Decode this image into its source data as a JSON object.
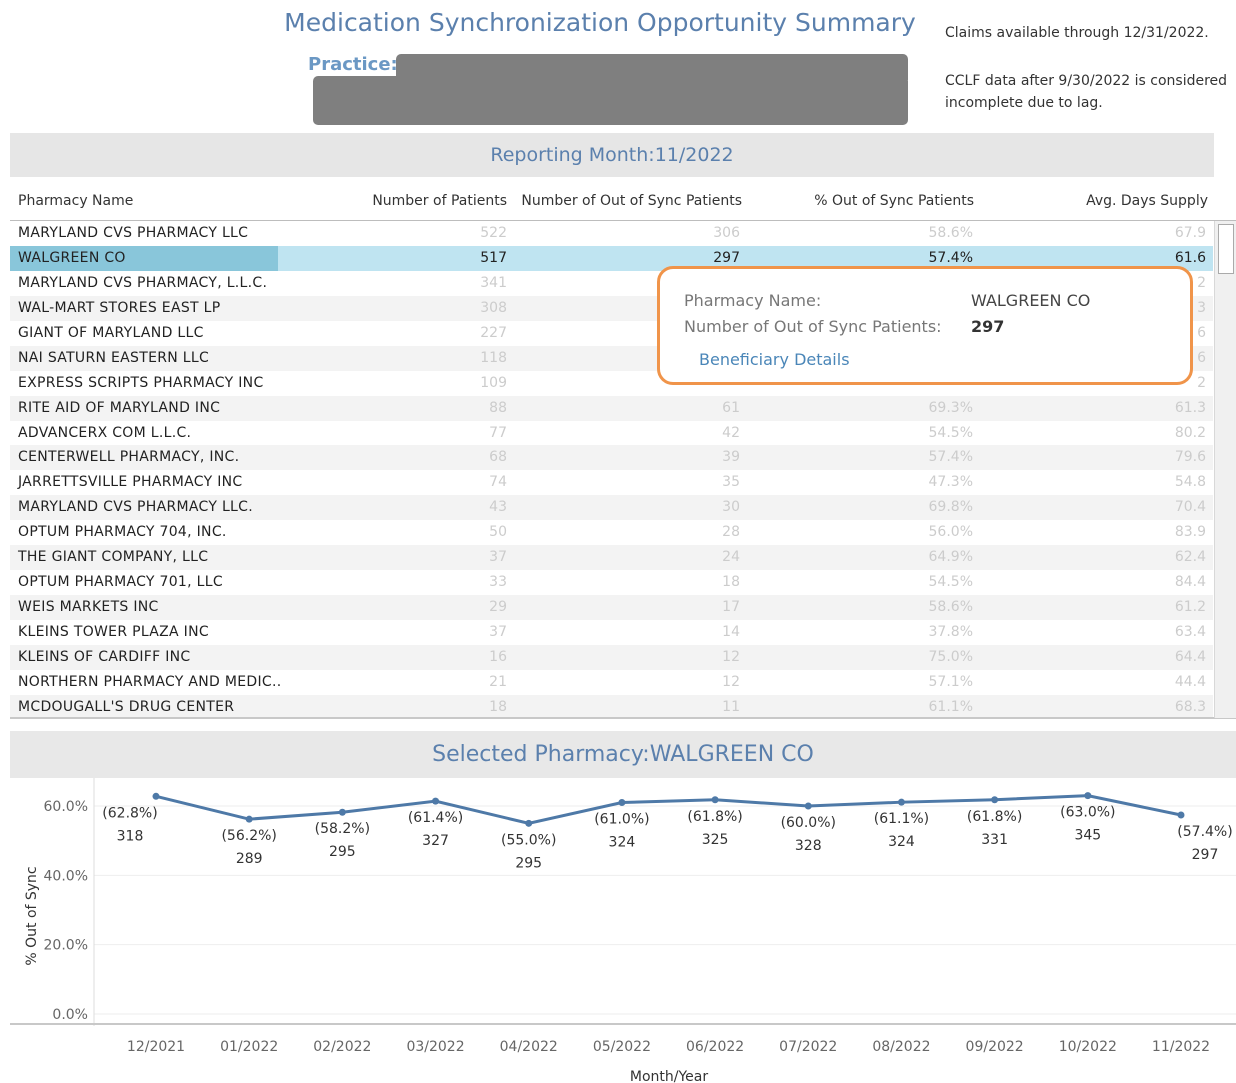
{
  "header": {
    "title": "Medication Synchronization Opportunity Summary",
    "practice_label": "Practice:",
    "claims_note": "Claims available through 12/31/2022.",
    "cclf_note": "CCLF data after 9/30/2022 is considered incomplete due to lag."
  },
  "reporting": {
    "label": "Reporting Month:11/2022"
  },
  "table": {
    "columns": [
      "Pharmacy Name",
      "Number of Patients",
      "Number of Out of Sync Patients",
      "% Out of Sync Patients",
      "Avg. Days Supply"
    ],
    "selected_index": 1,
    "rows": [
      [
        "MARYLAND CVS PHARMACY LLC",
        "522",
        "306",
        "58.6%",
        "67.9"
      ],
      [
        "WALGREEN CO",
        "517",
        "297",
        "57.4%",
        "61.6"
      ],
      [
        "MARYLAND CVS PHARMACY, L.L.C.",
        "341",
        "",
        "",
        "2"
      ],
      [
        "WAL-MART STORES EAST LP",
        "308",
        "",
        "",
        "3"
      ],
      [
        "GIANT OF MARYLAND LLC",
        "227",
        "",
        "",
        "6"
      ],
      [
        "NAI SATURN EASTERN LLC",
        "118",
        "",
        "",
        "6"
      ],
      [
        "EXPRESS SCRIPTS PHARMACY INC",
        "109",
        "",
        "",
        "2"
      ],
      [
        "RITE AID OF MARYLAND INC",
        "88",
        "61",
        "69.3%",
        "61.3"
      ],
      [
        "ADVANCERX COM L.L.C.",
        "77",
        "42",
        "54.5%",
        "80.2"
      ],
      [
        "CENTERWELL PHARMACY, INC.",
        "68",
        "39",
        "57.4%",
        "79.6"
      ],
      [
        "JARRETTSVILLE PHARMACY INC",
        "74",
        "35",
        "47.3%",
        "54.8"
      ],
      [
        "MARYLAND CVS PHARMACY LLC.",
        "43",
        "30",
        "69.8%",
        "70.4"
      ],
      [
        "OPTUM PHARMACY 704, INC.",
        "50",
        "28",
        "56.0%",
        "83.9"
      ],
      [
        "THE GIANT COMPANY, LLC",
        "37",
        "24",
        "64.9%",
        "62.4"
      ],
      [
        "OPTUM PHARMACY 701, LLC",
        "33",
        "18",
        "54.5%",
        "84.4"
      ],
      [
        "WEIS MARKETS INC",
        "29",
        "17",
        "58.6%",
        "61.2"
      ],
      [
        "KLEINS TOWER PLAZA INC",
        "37",
        "14",
        "37.8%",
        "63.4"
      ],
      [
        "KLEINS OF CARDIFF INC",
        "16",
        "12",
        "75.0%",
        "64.4"
      ],
      [
        "NORTHERN PHARMACY AND MEDIC..",
        "21",
        "12",
        "57.1%",
        "44.4"
      ],
      [
        "MCDOUGALL'S DRUG CENTER",
        "18",
        "11",
        "61.1%",
        "68.3"
      ]
    ]
  },
  "tooltip": {
    "name_label": "Pharmacy Name:",
    "name_value": "WALGREEN CO",
    "oos_label": "Number of Out of Sync Patients:",
    "oos_value": "297",
    "link": "Beneficiary Details",
    "border_color": "#f0944a"
  },
  "selected": {
    "label": "Selected Pharmacy:WALGREEN CO"
  },
  "chart_data": {
    "type": "line",
    "title": "Selected Pharmacy:WALGREEN CO",
    "xlabel": "Month/Year",
    "ylabel": "% Out of Sync",
    "ylim": [
      0,
      0.65
    ],
    "yticks": [
      "0.0%",
      "20.0%",
      "40.0%",
      "60.0%"
    ],
    "line_color": "#4e79a7",
    "x": [
      "12/2021",
      "01/2022",
      "02/2022",
      "03/2022",
      "04/2022",
      "05/2022",
      "06/2022",
      "07/2022",
      "08/2022",
      "09/2022",
      "10/2022",
      "11/2022"
    ],
    "values": [
      0.628,
      0.562,
      0.582,
      0.614,
      0.55,
      0.61,
      0.618,
      0.6,
      0.611,
      0.618,
      0.63,
      0.574
    ],
    "pct_labels": [
      "(62.8%)",
      "(56.2%)",
      "(58.2%)",
      "(61.4%)",
      "(55.0%)",
      "(61.0%)",
      "(61.8%)",
      "(60.0%)",
      "(61.1%)",
      "(61.8%)",
      "(63.0%)",
      "(57.4%)"
    ],
    "counts": [
      "318",
      "289",
      "295",
      "327",
      "295",
      "324",
      "325",
      "328",
      "324",
      "331",
      "345",
      "297"
    ]
  }
}
